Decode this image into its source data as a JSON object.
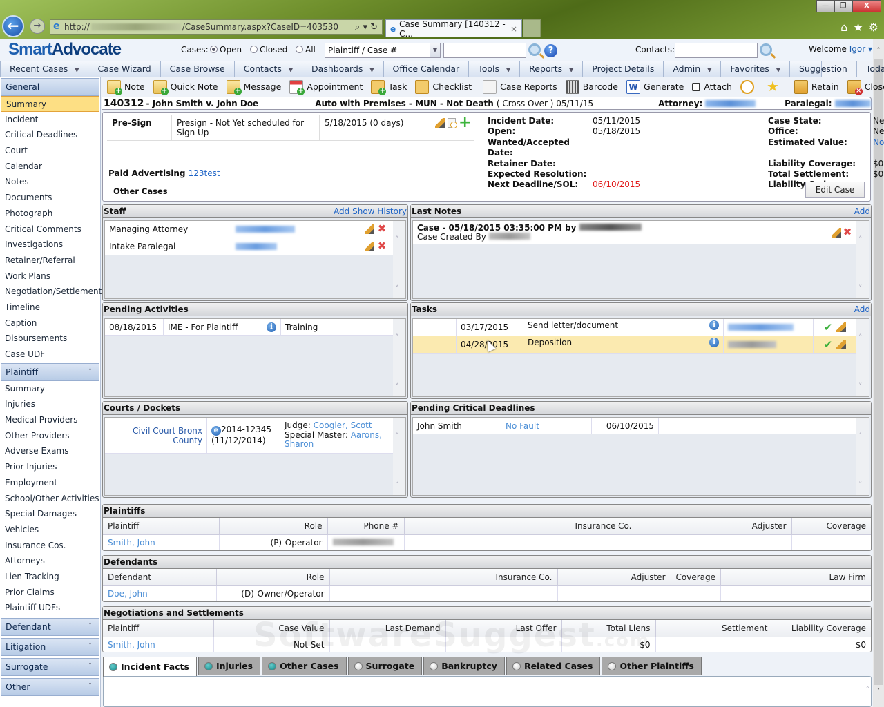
{
  "browser": {
    "url_prefix": "http://",
    "url_suffix": "/CaseSummary.aspx?CaseID=403530",
    "tab_title": "Case Summary [140312 - C...",
    "tab_close": "×",
    "url_tools": "⌕ ▾ ↻",
    "window_min": "—",
    "window_max": "❐",
    "window_close": "X",
    "home": "⌂",
    "favorites": "★",
    "settings": "⚙"
  },
  "header": {
    "logo_smart": "Smart",
    "logo_advocate": "Advocate",
    "cases_label": "Cases:",
    "case_filters": [
      {
        "label": "Open",
        "selected": true
      },
      {
        "label": "Closed",
        "selected": false
      },
      {
        "label": "All",
        "selected": false
      }
    ],
    "search_type": "Plaintiff / Case #",
    "search_value": "",
    "help": "?",
    "contacts_label": "Contacts:",
    "contacts_value": "",
    "welcome": "Welcome",
    "user": "Igor ▾"
  },
  "menubar": [
    {
      "label": "Recent Cases",
      "dropdown": true
    },
    {
      "label": "Case Wizard",
      "dropdown": false
    },
    {
      "label": "Case Browse",
      "dropdown": false
    },
    {
      "label": "Contacts",
      "dropdown": true
    },
    {
      "label": "Dashboards",
      "dropdown": true
    },
    {
      "label": "Office Calendar",
      "dropdown": false
    },
    {
      "label": "Tools",
      "dropdown": true
    },
    {
      "label": "Reports",
      "dropdown": true
    },
    {
      "label": "Project Details",
      "dropdown": false
    },
    {
      "label": "Admin",
      "dropdown": true
    },
    {
      "label": "Favorites",
      "dropdown": true
    },
    {
      "label": "Suggestion",
      "dropdown": false
    },
    {
      "label": "Today",
      "dropdown": false
    }
  ],
  "sidebar": {
    "general": {
      "label": "General",
      "items": [
        "Summary",
        "Incident",
        "Critical Deadlines",
        "Court",
        "Calendar",
        "Notes",
        "Documents",
        "Photograph",
        "Critical Comments",
        "Investigations",
        "Retainer/Referral",
        "Work Plans",
        "Negotiation/Settlement",
        "Timeline",
        "Caption",
        "Disbursements",
        "Case UDF"
      ],
      "active": "Summary"
    },
    "plaintiff": {
      "label": "Plaintiff",
      "expanded": true,
      "items": [
        "Summary",
        "Injuries",
        "Medical Providers",
        "Other Providers",
        "Adverse Exams",
        "Prior Injuries",
        "Employment",
        "School/Other Activities",
        "Special Damages",
        "Vehicles",
        "Insurance Cos.",
        "Attorneys",
        "Lien Tracking",
        "Prior Claims",
        "Plaintiff UDFs"
      ]
    },
    "collapsed": [
      "Defendant",
      "Litigation",
      "Surrogate",
      "Other"
    ],
    "chev_up": "˄",
    "chev_down": "˅"
  },
  "toolbar": [
    {
      "label": "Note",
      "icon": "note-icon"
    },
    {
      "label": "Quick Note",
      "icon": "quick-note-icon"
    },
    {
      "label": "Message",
      "icon": "message-icon"
    },
    {
      "label": "Appointment",
      "icon": "appointment-icon"
    },
    {
      "label": "Task",
      "icon": "task-icon"
    },
    {
      "label": "Checklist",
      "icon": "checklist-icon"
    },
    {
      "label": "Case Reports",
      "icon": "mail-icon"
    },
    {
      "label": "Barcode",
      "icon": "barcode-icon"
    },
    {
      "label": "Generate",
      "icon": "word-icon"
    },
    {
      "label": "Attach",
      "icon": "attach-icon"
    },
    {
      "label": "",
      "icon": "clock-icon"
    },
    {
      "label": "",
      "icon": "add-favorite-icon"
    },
    {
      "label": "Retain",
      "icon": "retain-icon"
    },
    {
      "label": "Close",
      "icon": "close-case-icon"
    }
  ],
  "case": {
    "number": "140312",
    "title": "- John Smith v. John Doe",
    "type": "Auto with Premises - MUN - Not Death",
    "subtype": "( Cross Over ) 05/11/15",
    "attorney_label": "Attorney:",
    "paralegal_label": "Paralegal:"
  },
  "summary": {
    "phase": {
      "name": "Pre-Sign",
      "status": "Presign - Not Yet scheduled for Sign Up",
      "date": "5/18/2015 (0 days)"
    },
    "paid_advertising_label": "Paid Advertising",
    "paid_advertising_value": "123test",
    "other_cases_label": "Other Cases",
    "facts": [
      {
        "k": "Incident Date:",
        "v": "05/11/2015",
        "k2": "Case State:",
        "v2": "New York"
      },
      {
        "k": "Open:",
        "v": "05/18/2015",
        "k2": "Office:",
        "v2": "New York"
      },
      {
        "k": "Wanted/Accepted Date:",
        "v": "",
        "k2": "Estimated Value:",
        "v2": "Not Set"
      },
      {
        "k": "Retainer Date:",
        "v": "",
        "k2": "Liability Coverage:",
        "v2": "$0"
      },
      {
        "k": "Expected Resolution:",
        "v": "",
        "k2": "Total Settlement:",
        "v2": "$0"
      },
      {
        "k": "Next Deadline/SOL:",
        "v": "06/10/2015",
        "k2": "Liability Code:",
        "v2": ""
      }
    ],
    "edit_case": "Edit Case",
    "deadline_color": "#e21b1b"
  },
  "staff": {
    "title": "Staff",
    "actions": "Add Show History",
    "rows": [
      {
        "role": "Managing Attorney"
      },
      {
        "role": "Intake Paralegal"
      }
    ]
  },
  "last_notes": {
    "title": "Last Notes",
    "action": "Add",
    "rows": [
      {
        "heading": "Case - 05/18/2015 03:35:00 PM by",
        "body": "Case Created By"
      }
    ]
  },
  "pending_activities": {
    "title": "Pending Activities",
    "rows": [
      {
        "date": "08/18/2015",
        "name": "IME - For Plaintiff",
        "type": "Training"
      }
    ]
  },
  "tasks": {
    "title": "Tasks",
    "action": "Add",
    "rows": [
      {
        "date": "03/17/2015",
        "name": "Send letter/document",
        "highlighted": false
      },
      {
        "date": "04/28/2015",
        "name": "Deposition",
        "highlighted": true
      }
    ]
  },
  "courts": {
    "title": "Courts / Dockets",
    "rows": [
      {
        "court": "Civil Court Bronx County",
        "docket": "2014-12345",
        "docket_date": "(11/12/2014)",
        "judge_label": "Judge:",
        "judge": "Coogler, Scott",
        "master_label": "Special Master:",
        "master": "Aarons, Sharon"
      }
    ]
  },
  "critical_deadlines": {
    "title": "Pending Critical Deadlines",
    "rows": [
      {
        "name": "John Smith",
        "type": "No Fault",
        "date": "06/10/2015"
      }
    ]
  },
  "plaintiffs": {
    "title": "Plaintiffs",
    "columns": [
      "Plaintiff",
      "Role",
      "Phone #",
      "Insurance Co.",
      "Adjuster",
      "Coverage"
    ],
    "rows": [
      {
        "name": "Smith, John",
        "role": "(P)-Operator"
      }
    ]
  },
  "defendants": {
    "title": "Defendants",
    "columns": [
      "Defendant",
      "Role",
      "Insurance Co.",
      "Adjuster",
      "Coverage",
      "Law Firm"
    ],
    "rows": [
      {
        "name": "Doe, John",
        "role": "(D)-Owner/Operator"
      }
    ]
  },
  "negotiations": {
    "title": "Negotiations and Settlements",
    "columns": [
      "Plaintiff",
      "Case Value",
      "Last Demand",
      "Last Offer",
      "Total Liens",
      "Settlement",
      "Liability Coverage"
    ],
    "rows": [
      {
        "plaintiff": "Smith, John",
        "case_value": "Not Set",
        "last_demand": "",
        "last_offer": "",
        "total_liens": "$0",
        "settlement": "",
        "liability_coverage": "$0"
      }
    ]
  },
  "bottom_tabs": [
    {
      "label": "Incident Facts",
      "active": true,
      "indicator": "teal"
    },
    {
      "label": "Injuries",
      "active": false,
      "indicator": "teal"
    },
    {
      "label": "Other Cases",
      "active": false,
      "indicator": "teal"
    },
    {
      "label": "Surrogate",
      "active": false,
      "indicator": "gray"
    },
    {
      "label": "Bankruptcy",
      "active": false,
      "indicator": "gray"
    },
    {
      "label": "Related Cases",
      "active": false,
      "indicator": "gray"
    },
    {
      "label": "Other Plaintiffs",
      "active": false,
      "indicator": "gray"
    }
  ],
  "watermark": {
    "main": "SoftwareSuggest",
    "suffix": ".com"
  },
  "scroll": {
    "up": "˄",
    "down": "˅"
  }
}
